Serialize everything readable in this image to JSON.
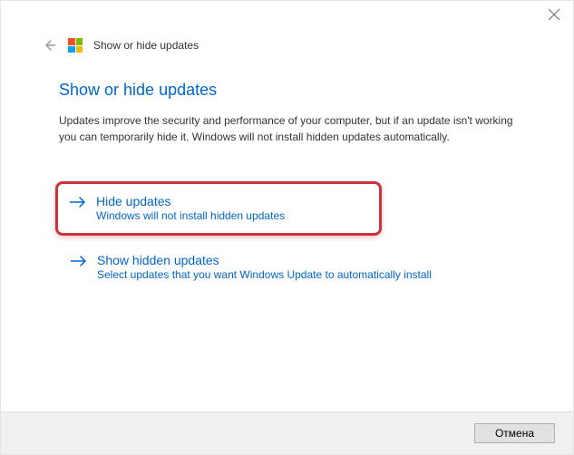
{
  "header": {
    "title": "Show or hide updates"
  },
  "main": {
    "title": "Show or hide updates",
    "description": "Updates improve the security and performance of your computer, but if an update isn't working you can temporarily hide it. Windows will not install hidden updates automatically."
  },
  "options": [
    {
      "title": "Hide updates",
      "subtitle": "Windows will not install hidden updates"
    },
    {
      "title": "Show hidden updates",
      "subtitle": "Select updates that you want Windows Update to automatically install"
    }
  ],
  "footer": {
    "cancel_label": "Отмена"
  }
}
